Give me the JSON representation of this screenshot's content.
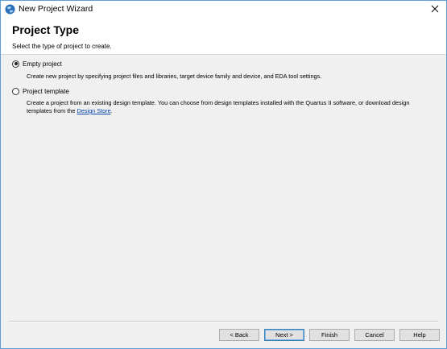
{
  "window": {
    "title": "New Project Wizard",
    "app_icon": "quartus-globe-icon",
    "close_icon": "close-icon"
  },
  "header": {
    "title": "Project Type",
    "subtitle": "Select the type of project to create."
  },
  "options": [
    {
      "label": "Empty project",
      "selected": true,
      "description": "Create new project by specifying project files and libraries, target device family and device, and EDA tool settings."
    },
    {
      "label": "Project template",
      "selected": false,
      "description_before_link": "Create a project from an existing design template. You can choose from design templates installed with the Quartus II software, or download design templates from the ",
      "link_text": "Design Store",
      "description_after_link": "."
    }
  ],
  "buttons": {
    "back": "< Back",
    "next": "Next >",
    "finish": "Finish",
    "cancel": "Cancel",
    "help": "Help"
  },
  "colors": {
    "accent_border": "#5f9fd6",
    "link": "#0645ad",
    "dialog_bg": "#f0f0f0"
  }
}
